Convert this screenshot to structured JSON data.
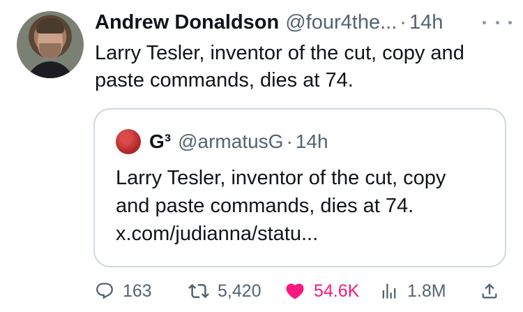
{
  "tweet": {
    "author_name": "Andrew Donaldson",
    "author_handle": "@four4the...",
    "separator": "·",
    "time": "14h",
    "text": "Larry Tesler, inventor of the cut, copy and paste commands, dies at 74."
  },
  "quoted_tweet": {
    "author_name": "G³",
    "author_handle": "@armatusG",
    "separator": "·",
    "time": "14h",
    "text_line1": "Larry Tesler, inventor of the cut, copy",
    "text_line2": "and paste commands, dies at 74.",
    "text_line3": "x.com/judianna/statu..."
  },
  "actions": {
    "replies": "163",
    "retweets": "5,420",
    "likes": "54.6K",
    "views": "1.8M"
  },
  "icons": {
    "reply": "reply-icon",
    "retweet": "retweet-icon",
    "like": "heart-icon",
    "views": "views-icon",
    "share": "share-icon",
    "more": "more-icon"
  },
  "colors": {
    "text": "#0f1419",
    "secondary": "#536471",
    "like": "#f91880",
    "border": "#cfd9de"
  }
}
